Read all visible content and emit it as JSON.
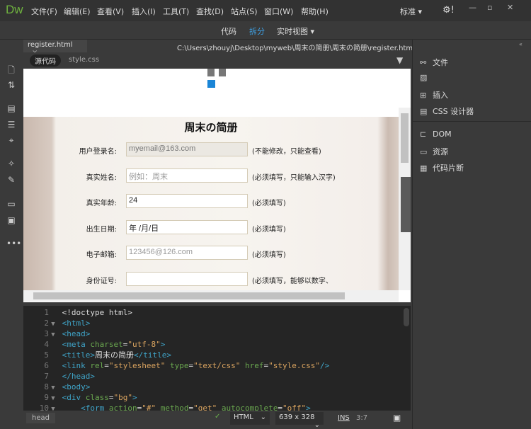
{
  "app": {
    "logo": "Dw",
    "menu": [
      "文件(F)",
      "编辑(E)",
      "查看(V)",
      "插入(I)",
      "工具(T)",
      "查找(D)",
      "站点(S)",
      "窗口(W)",
      "帮助(H)"
    ],
    "workspace": "标准",
    "window_controls": [
      "minimize",
      "maximize",
      "close"
    ]
  },
  "toolbar": {
    "views": [
      "代码",
      "拆分",
      "实时视图"
    ],
    "active": "拆分",
    "accent": "#3ea2e6"
  },
  "document": {
    "tab": "register.html",
    "path": "C:\\Users\\zhouyj\\Desktop\\myweb\\周末の简册\\周末の简册\\register.html",
    "related": [
      "源代码",
      "style.css"
    ]
  },
  "form": {
    "title": "周末の简册",
    "rows": [
      {
        "label": "用户登录名:",
        "value": "myemail@163.com",
        "placeholder": "",
        "hint": "(不能修改，只能查看)",
        "readonly": true
      },
      {
        "label": "真实姓名:",
        "value": "",
        "placeholder": "例如：周末",
        "hint": "(必须填写，只能输入汉字)"
      },
      {
        "label": "真实年龄:",
        "value": "24",
        "placeholder": "",
        "hint": "(必须填写)"
      },
      {
        "label": "出生日期:",
        "value": "  年 /月/日",
        "placeholder": "",
        "hint": "(必须填写)"
      },
      {
        "label": "电子邮箱:",
        "value": "",
        "placeholder": "123456@126.com",
        "hint": "(必须填写)"
      },
      {
        "label": "身份证号:",
        "value": "",
        "placeholder": "",
        "hint": "(必须填写，能够以数字、"
      }
    ]
  },
  "code": {
    "lines": [
      {
        "n": "1",
        "fold": false,
        "parts": [
          [
            "p",
            "<!doctype html>"
          ]
        ]
      },
      {
        "n": "2",
        "fold": true,
        "parts": [
          [
            "t",
            "<html>"
          ]
        ]
      },
      {
        "n": "3",
        "fold": true,
        "parts": [
          [
            "t",
            "<head>"
          ]
        ]
      },
      {
        "n": "4",
        "fold": false,
        "parts": [
          [
            "t",
            "<meta "
          ],
          [
            "a",
            "charset"
          ],
          [
            "p",
            "="
          ],
          [
            "s",
            "\"utf-8\""
          ],
          [
            "t",
            ">"
          ]
        ]
      },
      {
        "n": "5",
        "fold": false,
        "parts": [
          [
            "t",
            "<title>"
          ],
          [
            "p",
            "周末の简册"
          ],
          [
            "t",
            "</title>"
          ]
        ]
      },
      {
        "n": "6",
        "fold": false,
        "parts": [
          [
            "t",
            "<link "
          ],
          [
            "a",
            "rel"
          ],
          [
            "p",
            "="
          ],
          [
            "s",
            "\"stylesheet\""
          ],
          [
            "a",
            " type"
          ],
          [
            "p",
            "="
          ],
          [
            "s",
            "\"text/css\""
          ],
          [
            "a",
            " href"
          ],
          [
            "p",
            "="
          ],
          [
            "s",
            "\"style.css\""
          ],
          [
            "t",
            "/>"
          ]
        ]
      },
      {
        "n": "7",
        "fold": false,
        "parts": [
          [
            "t",
            "</head>"
          ]
        ]
      },
      {
        "n": "8",
        "fold": true,
        "parts": [
          [
            "t",
            "<body>"
          ]
        ]
      },
      {
        "n": "9",
        "fold": true,
        "parts": [
          [
            "t",
            "<div "
          ],
          [
            "a",
            "class"
          ],
          [
            "p",
            "="
          ],
          [
            "s",
            "\"bg\""
          ],
          [
            "t",
            ">"
          ]
        ]
      },
      {
        "n": "10",
        "fold": true,
        "parts": [
          [
            "p",
            "    "
          ],
          [
            "t",
            "<form "
          ],
          [
            "a",
            "action"
          ],
          [
            "p",
            "="
          ],
          [
            "s",
            "\"#\""
          ],
          [
            "a",
            " method"
          ],
          [
            "p",
            "="
          ],
          [
            "s",
            "\"get\""
          ],
          [
            "a",
            " autocomplete"
          ],
          [
            "p",
            "="
          ],
          [
            "s",
            "\"off\""
          ],
          [
            "t",
            ">"
          ]
        ]
      }
    ]
  },
  "status": {
    "tag": "head",
    "language": "HTML",
    "size": "639 x 328",
    "mode": "INS",
    "position": "3:7"
  },
  "panels": {
    "items": [
      "文件",
      "",
      "插入",
      "CSS 设计器",
      "DOM",
      "资源",
      "代码片断"
    ]
  }
}
